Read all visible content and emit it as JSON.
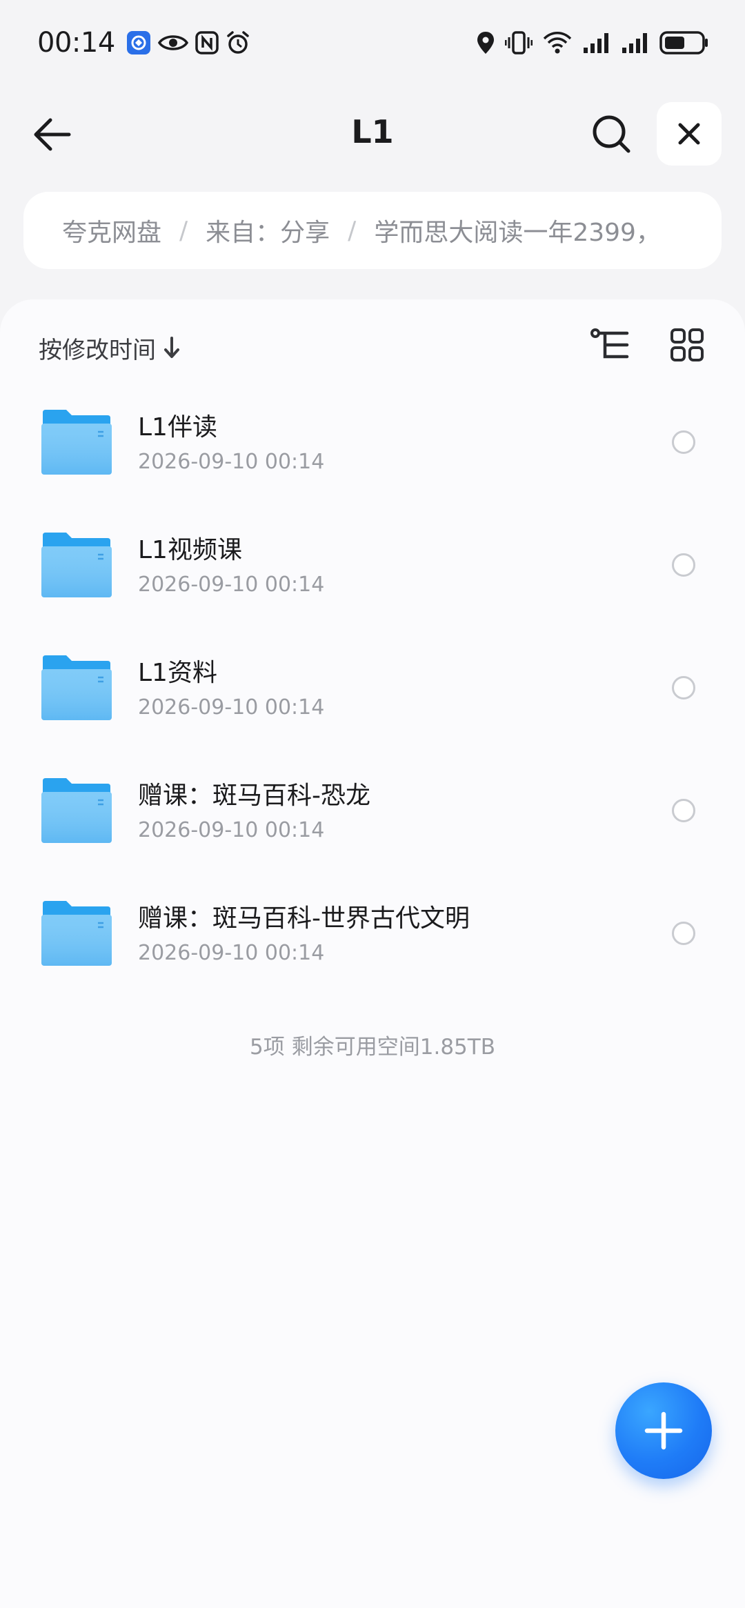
{
  "status_bar": {
    "time": "00:14",
    "left_icons": [
      "app-notification-icon",
      "eye-icon",
      "nfc-icon",
      "alarm-icon"
    ],
    "right_icons": [
      "location-icon",
      "vibrate-icon",
      "wifi-icon",
      "signal-icon",
      "signal-icon",
      "battery-icon"
    ]
  },
  "header": {
    "title": "L1",
    "back_icon": "arrow-left-icon",
    "search_icon": "search-icon",
    "close_icon": "close-icon"
  },
  "breadcrumb": {
    "items": [
      "夸克网盘",
      "来自：分享",
      "学而思大阅读一年2399，"
    ],
    "separator": "/"
  },
  "sort": {
    "label": "按修改时间",
    "direction_icon": "arrow-down-icon"
  },
  "view_controls": {
    "tree_icon": "tree-view-icon",
    "grid_icon": "grid-view-icon"
  },
  "files": [
    {
      "name": "L1伴读",
      "date": "2026-09-10 00:14",
      "icon": "folder-icon"
    },
    {
      "name": "L1视频课",
      "date": "2026-09-10 00:14",
      "icon": "folder-icon"
    },
    {
      "name": "L1资料",
      "date": "2026-09-10 00:14",
      "icon": "folder-icon"
    },
    {
      "name": "赠课：斑马百科-恐龙",
      "date": "2026-09-10 00:14",
      "icon": "folder-icon"
    },
    {
      "name": "赠课：斑马百科-世界古代文明",
      "date": "2026-09-10 00:14",
      "icon": "folder-icon"
    }
  ],
  "footer": {
    "count": "5项",
    "storage": "剩余可用空间1.85TB"
  },
  "fab": {
    "icon": "plus-icon"
  },
  "colors": {
    "accent": "#1f7cf7",
    "folder": "#5bb8f5",
    "background": "#f4f4f6",
    "panel": "#fbfbfd"
  }
}
